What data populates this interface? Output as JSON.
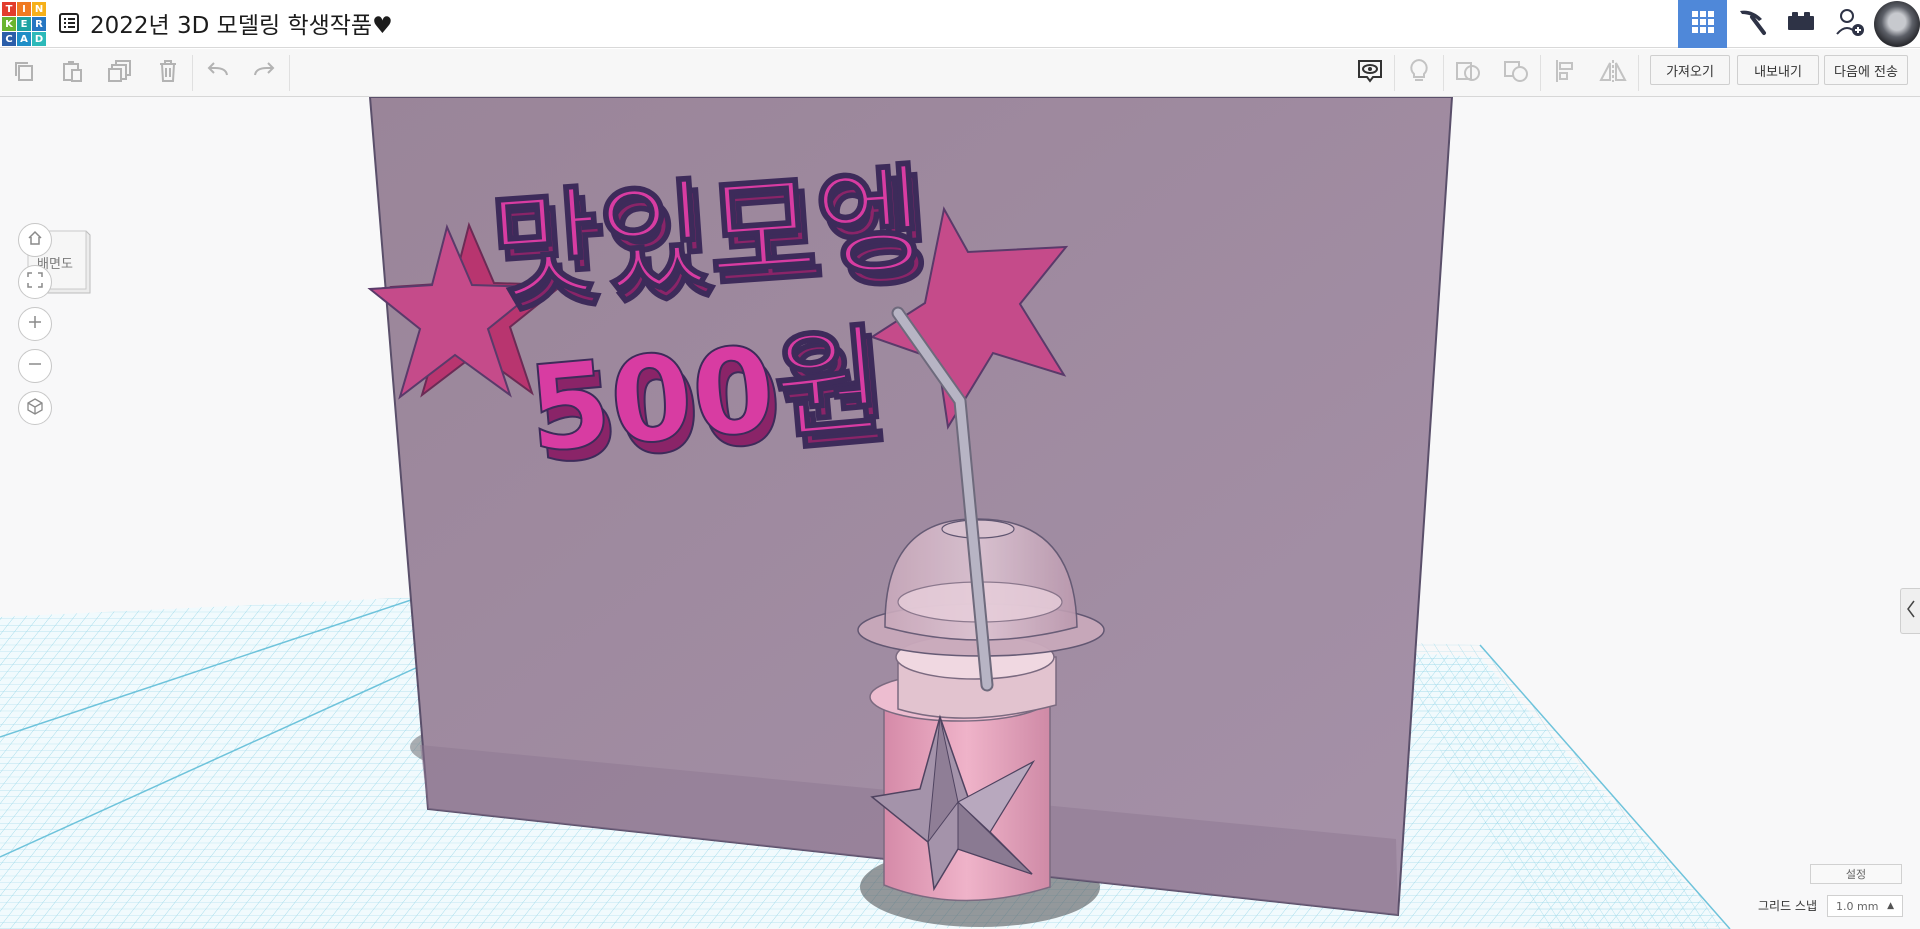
{
  "app": {
    "logo_letters": [
      "T",
      "I",
      "N",
      "K",
      "E",
      "R",
      "C",
      "A",
      "D"
    ],
    "title": "2022년 3D 모델링 학생작품♥"
  },
  "header": {
    "view_buttons": [
      {
        "name": "3d-design-view",
        "icon": "grid-icon"
      },
      {
        "name": "blocks-view",
        "icon": "pickaxe-icon"
      },
      {
        "name": "bricks-view",
        "icon": "brick-icon"
      },
      {
        "name": "add-user",
        "icon": "add-user-icon"
      },
      {
        "name": "avatar",
        "icon": "avatar-image"
      }
    ]
  },
  "toolbar": {
    "left_tools": [
      "copy",
      "paste",
      "duplicate",
      "delete",
      "undo",
      "redo"
    ],
    "right_tools": [
      "notes",
      "light",
      "shape-generator",
      "group",
      "align",
      "mirror"
    ],
    "import_label": "가져오기",
    "export_label": "내보내기",
    "send_to_label": "다음에 전송"
  },
  "navigation": {
    "cube_label": "배면도",
    "controls": [
      "home",
      "fit-all",
      "zoom-in",
      "zoom-out",
      "perspective"
    ]
  },
  "scene": {
    "sign_text_line1": "맛있모엥",
    "sign_text_line2": "500원",
    "colors": {
      "board": "#9f8aa2",
      "text": "#d83ca2",
      "text_dark": "#a5287b",
      "star": "#c54b8a",
      "cup": "#e7a2bd",
      "grid": "#8fd4e6",
      "accent": "#4f88d9"
    }
  },
  "footer": {
    "settings_label": "설정",
    "grid_snap_label": "그리드 스냅",
    "grid_snap_value": "1.0 mm"
  }
}
